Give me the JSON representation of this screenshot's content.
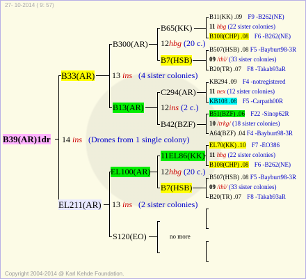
{
  "header_date": "27- 10-2014 ( 9: 57)",
  "footer": "Copyright 2004-2014 @ Karl Kehde Foundation.",
  "root": {
    "name": "B39(AR)1dr",
    "gen": "14",
    "ins": "ins",
    "note": "(Drones from 1 single colony)"
  },
  "g1a": {
    "name": "B33(AR)",
    "gen": "13",
    "ins": "ins",
    "note": "(4 sister colonies)"
  },
  "g1b": {
    "name": "EL211(AR)",
    "gen": "13",
    "ins": "ins",
    "note": "(2 sister colonies)"
  },
  "g2a": {
    "name": "B300(AR)"
  },
  "g2b": {
    "name": "B13(AR)"
  },
  "g2c": {
    "name": "EL100(AR)"
  },
  "g2d": {
    "name": "S120(EO)",
    "extra": "no more"
  },
  "g3a": {
    "name": "B65(KK)"
  },
  "g3a_note": {
    "gen": "12",
    "ins": "hbg",
    "note": "(20 c.)"
  },
  "g3b": {
    "name": "B7(HSB)"
  },
  "g3c": {
    "name": "C294(AR)"
  },
  "g3c_note": {
    "gen": "12",
    "ins": "ins",
    "note": "(2 c.)"
  },
  "g3d": {
    "name": "B42(BZF)"
  },
  "g3e": {
    "name": "11EL86(KK)"
  },
  "g3e_note": {
    "gen": "12",
    "ins": "hbg",
    "note": "(20 c.)"
  },
  "g3f": {
    "name": "B7(HSB)"
  },
  "g4": [
    {
      "name": "B11(KK) .09",
      "sep": "F9 -B262(NE)"
    },
    {
      "gen": "11",
      "ins": "hbg",
      "note": "(22 sister colonies)"
    },
    {
      "name": "B108(CHP) .08",
      "sep": "F6 -B262(NE)"
    },
    {
      "name": "B507(HSB) .08",
      "sep": "F5 -Bayburt98-3R"
    },
    {
      "gen": "09",
      "ins": "/thl/",
      "note": "(33 sister colonies)"
    },
    {
      "name": "B20(TR) .07",
      "sep": "F8 -Takab93aR"
    },
    {
      "name": "KB294 .09",
      "sep": "F4 -notregistered"
    },
    {
      "gen": "11",
      "ins": "nex",
      "note": "(12 sister colonies)"
    },
    {
      "name": "KB108 .08",
      "sep": "F5 -Carpath00R"
    },
    {
      "name": "B51(BZF) .06",
      "sep": "F22 -Sinop62R"
    },
    {
      "gen": "10",
      "ins": "/trkg/",
      "note": "(18 sister colonies)"
    },
    {
      "name": "A64(BZF) .04",
      "sep": "F4 -Bayburt98-3R"
    },
    {
      "name": "EL70(KK) .10",
      "sep": "F7 -EO386"
    },
    {
      "gen": "11",
      "ins": "hbg",
      "note": "(22 sister colonies)"
    },
    {
      "name": "B108(CHP) .08",
      "sep": "F6 -B262(NE)"
    },
    {
      "name": "B507(HSB) .08",
      "sep": "F5 -Bayburt98-3R"
    },
    {
      "gen": "09",
      "ins": "/thl/",
      "note": "(33 sister colonies)"
    },
    {
      "name": "B20(TR) .07",
      "sep": "F8 -Takab93aR"
    }
  ]
}
